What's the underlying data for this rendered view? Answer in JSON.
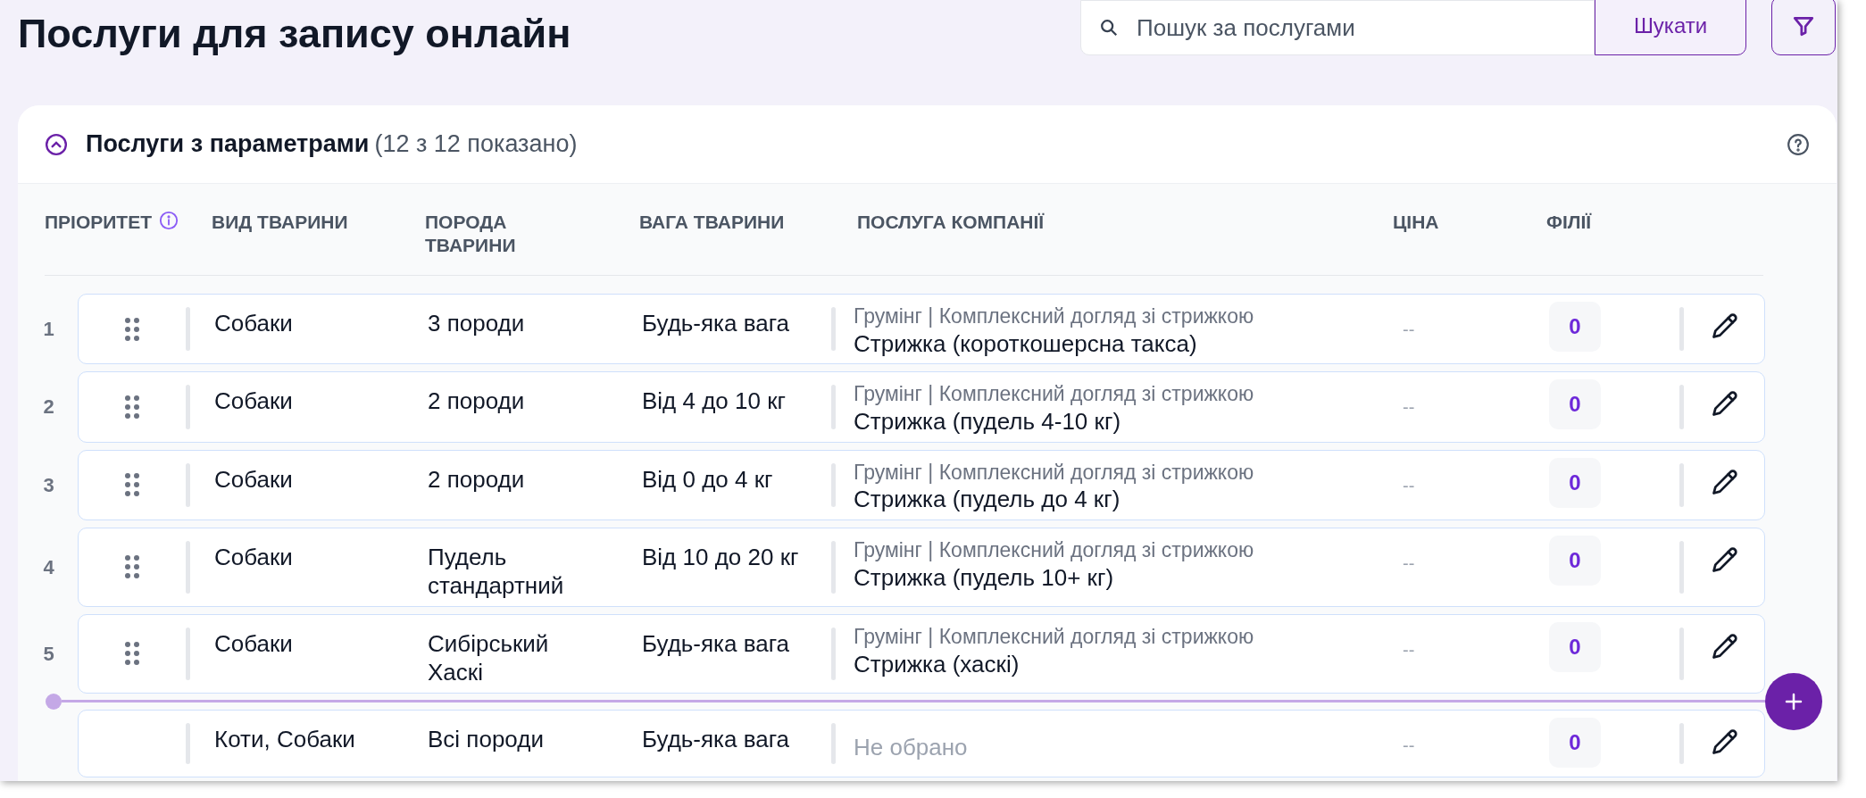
{
  "page_title": "Послуги для запису онлайн",
  "search": {
    "placeholder": "Пошук за послугами",
    "button": "Шукати"
  },
  "section": {
    "title": "Послуги з параметрами",
    "count": "(12 з 12 показано)",
    "expanded": true
  },
  "table": {
    "columns": [
      "ПРІОРИТЕТ",
      "ВИД ТВАРИНИ",
      "ПОРОДА ТВАРИНИ",
      "ВАГА ТВАРИНИ",
      "ПОСЛУГА КОМПАНІЇ",
      "ЦІНА",
      "ФІЛІЇ"
    ],
    "rows": [
      {
        "priority": "1",
        "draggable": true,
        "species": "Собаки",
        "breed": "3 породи",
        "weight": "Будь-яка вага",
        "service": {
          "kind": "chosen",
          "category": "Грумінг | Комплексний догляд зі стрижкою",
          "name": "Стрижка (короткошерсна такса)"
        },
        "price": "--",
        "branches": "0",
        "drop_indicator_below": false
      },
      {
        "priority": "2",
        "draggable": true,
        "species": "Собаки",
        "breed": "2 породи",
        "weight": "Від 4 до 10 кг",
        "service": {
          "kind": "chosen",
          "category": "Грумінг | Комплексний догляд зі стрижкою",
          "name": "Стрижка (пудель 4-10 кг)"
        },
        "price": "--",
        "branches": "0",
        "drop_indicator_below": false
      },
      {
        "priority": "3",
        "draggable": true,
        "species": "Собаки",
        "breed": "2 породи",
        "weight": "Від 0 до 4 кг",
        "service": {
          "kind": "chosen",
          "category": "Грумінг | Комплексний догляд зі стрижкою",
          "name": "Стрижка (пудель до 4 кг)"
        },
        "price": "--",
        "branches": "0",
        "drop_indicator_below": false
      },
      {
        "priority": "4",
        "draggable": true,
        "species": "Собаки",
        "breed": "Пудель стандартний",
        "weight": "Від 10 до 20 кг",
        "service": {
          "kind": "chosen",
          "category": "Грумінг | Комплексний догляд зі стрижкою",
          "name": "Стрижка (пудель 10+ кг)"
        },
        "price": "--",
        "branches": "0",
        "drop_indicator_below": false
      },
      {
        "priority": "5",
        "draggable": true,
        "species": "Собаки",
        "breed": "Сибірський Хаскі",
        "weight": "Будь-яка вага",
        "service": {
          "kind": "chosen",
          "category": "Грумінг | Комплексний догляд зі стрижкою",
          "name": "Стрижка (хаскі)"
        },
        "price": "--",
        "branches": "0",
        "drop_indicator_below": true
      },
      {
        "draggable": false,
        "species": "Коти, Собаки",
        "breed": "Всі породи",
        "weight": "Будь-яка вага",
        "service": {
          "kind": "empty",
          "placeholder": "Не обрано"
        },
        "price": "--",
        "branches": "0",
        "drop_indicator_below": false
      }
    ]
  }
}
